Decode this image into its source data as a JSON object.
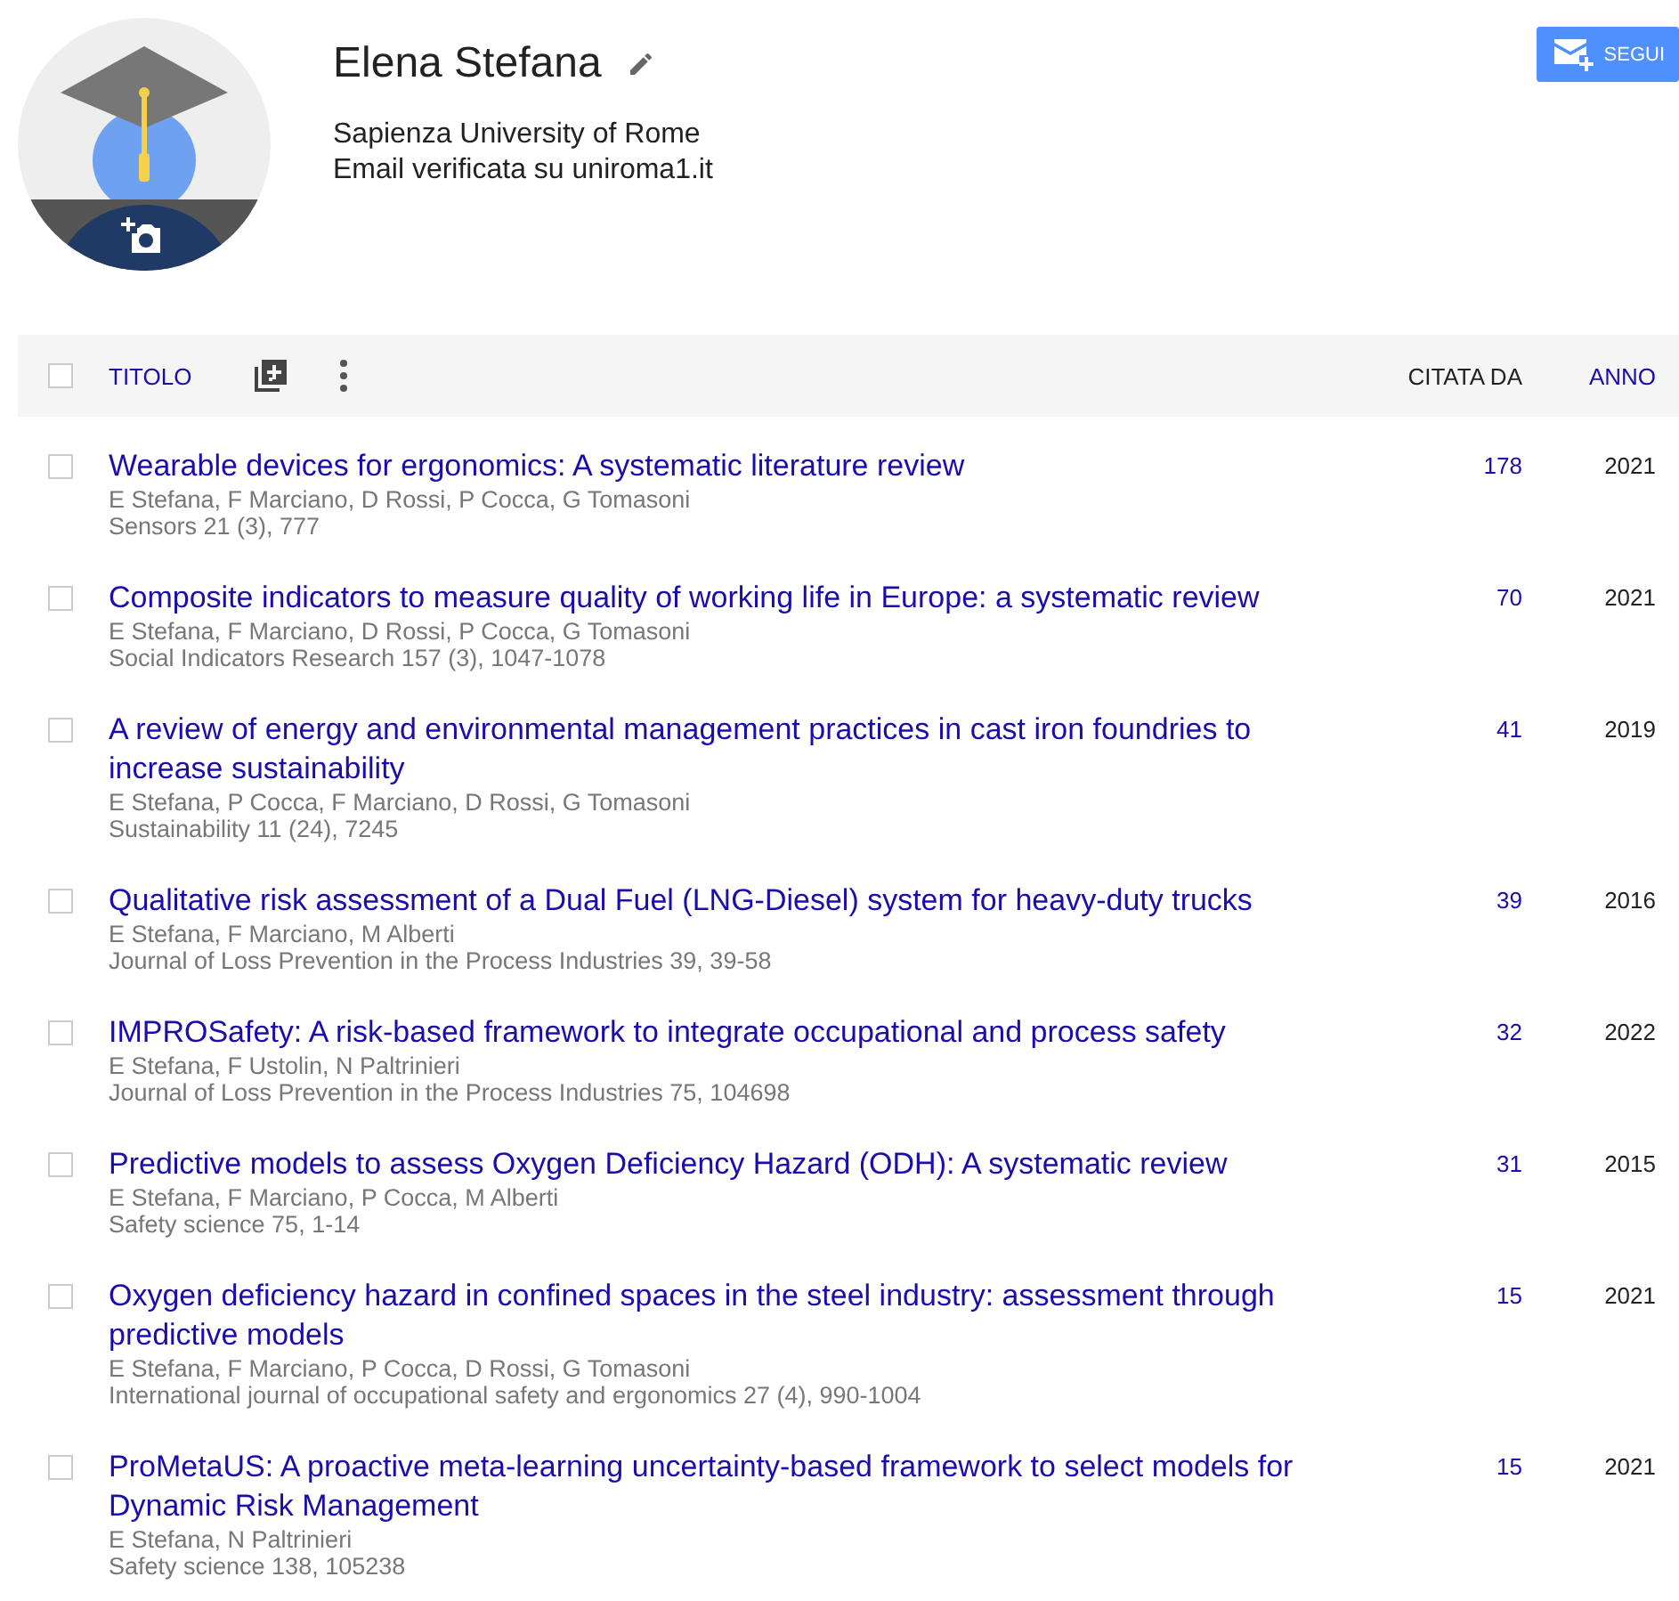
{
  "profile": {
    "name": "Elena Stefana",
    "affiliation": "Sapienza University of Rome",
    "email": "Email verificata su uniroma1.it",
    "follow_button": "SEGUI"
  },
  "table": {
    "header": {
      "checked": false,
      "title": "TITOLO",
      "cited_by": "CITATA DA",
      "year": "ANNO"
    },
    "rows": [
      {
        "checked": false,
        "title": "Wearable devices for ergonomics: A systematic literature review",
        "authors": "E Stefana, F Marciano, D Rossi, P Cocca, G Tomasoni",
        "venue": "Sensors 21 (3), 777",
        "cited_by": "178",
        "year": "2021"
      },
      {
        "checked": false,
        "title": "Composite indicators to measure quality of working life in Europe: a systematic review",
        "authors": "E Stefana, F Marciano, D Rossi, P Cocca, G Tomasoni",
        "venue": "Social Indicators Research 157 (3), 1047-1078",
        "cited_by": "70",
        "year": "2021"
      },
      {
        "checked": false,
        "title": "A review of energy and environmental management practices in cast iron foundries to increase sustainability",
        "authors": "E Stefana, P Cocca, F Marciano, D Rossi, G Tomasoni",
        "venue": "Sustainability 11 (24), 7245",
        "cited_by": "41",
        "year": "2019"
      },
      {
        "checked": false,
        "title": "Qualitative risk assessment of a Dual Fuel (LNG-Diesel) system for heavy-duty trucks",
        "authors": "E Stefana, F Marciano, M Alberti",
        "venue": "Journal of Loss Prevention in the Process Industries 39, 39-58",
        "cited_by": "39",
        "year": "2016"
      },
      {
        "checked": false,
        "title": "IMPROSafety: A risk-based framework to integrate occupational and process safety",
        "authors": "E Stefana, F Ustolin, N Paltrinieri",
        "venue": "Journal of Loss Prevention in the Process Industries 75, 104698",
        "cited_by": "32",
        "year": "2022"
      },
      {
        "checked": false,
        "title": "Predictive models to assess Oxygen Deficiency Hazard (ODH): A systematic review",
        "authors": "E Stefana, F Marciano, P Cocca, M Alberti",
        "venue": "Safety science 75, 1-14",
        "cited_by": "31",
        "year": "2015"
      },
      {
        "checked": false,
        "title": "Oxygen deficiency hazard in confined spaces in the steel industry: assessment through predictive models",
        "authors": "E Stefana, F Marciano, P Cocca, D Rossi, G Tomasoni",
        "venue": "International journal of occupational safety and ergonomics 27 (4), 990-1004",
        "cited_by": "15",
        "year": "2021"
      },
      {
        "checked": false,
        "title": "ProMetaUS: A proactive meta-learning uncertainty-based framework to select models for Dynamic Risk Management",
        "authors": "E Stefana, N Paltrinieri",
        "venue": "Safety science 138, 105238",
        "cited_by": "15",
        "year": "2021"
      }
    ]
  }
}
